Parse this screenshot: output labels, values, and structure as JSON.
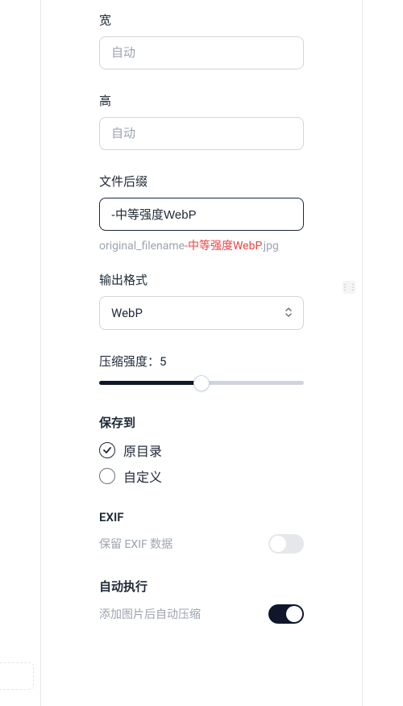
{
  "width": {
    "label": "宽",
    "placeholder": "自动",
    "value": ""
  },
  "height": {
    "label": "高",
    "placeholder": "自动",
    "value": ""
  },
  "suffix": {
    "label": "文件后缀",
    "value": "-中等强度WebP",
    "hint_prefix": "original_filename",
    "hint_highlight": "-中等强度WebP",
    "hint_ext": ".jpg"
  },
  "format": {
    "label": "输出格式",
    "value": "WebP"
  },
  "compression": {
    "label_prefix": "压缩强度：",
    "value": "5",
    "min": 0,
    "max": 10,
    "percent": 50
  },
  "save": {
    "title": "保存到",
    "options": {
      "original": "原目录",
      "custom": "自定义"
    },
    "selected": "original"
  },
  "exif": {
    "title": "EXIF",
    "desc": "保留 EXIF 数据",
    "enabled": false
  },
  "auto": {
    "title": "自动执行",
    "desc": "添加图片后自动压缩",
    "enabled": true
  }
}
